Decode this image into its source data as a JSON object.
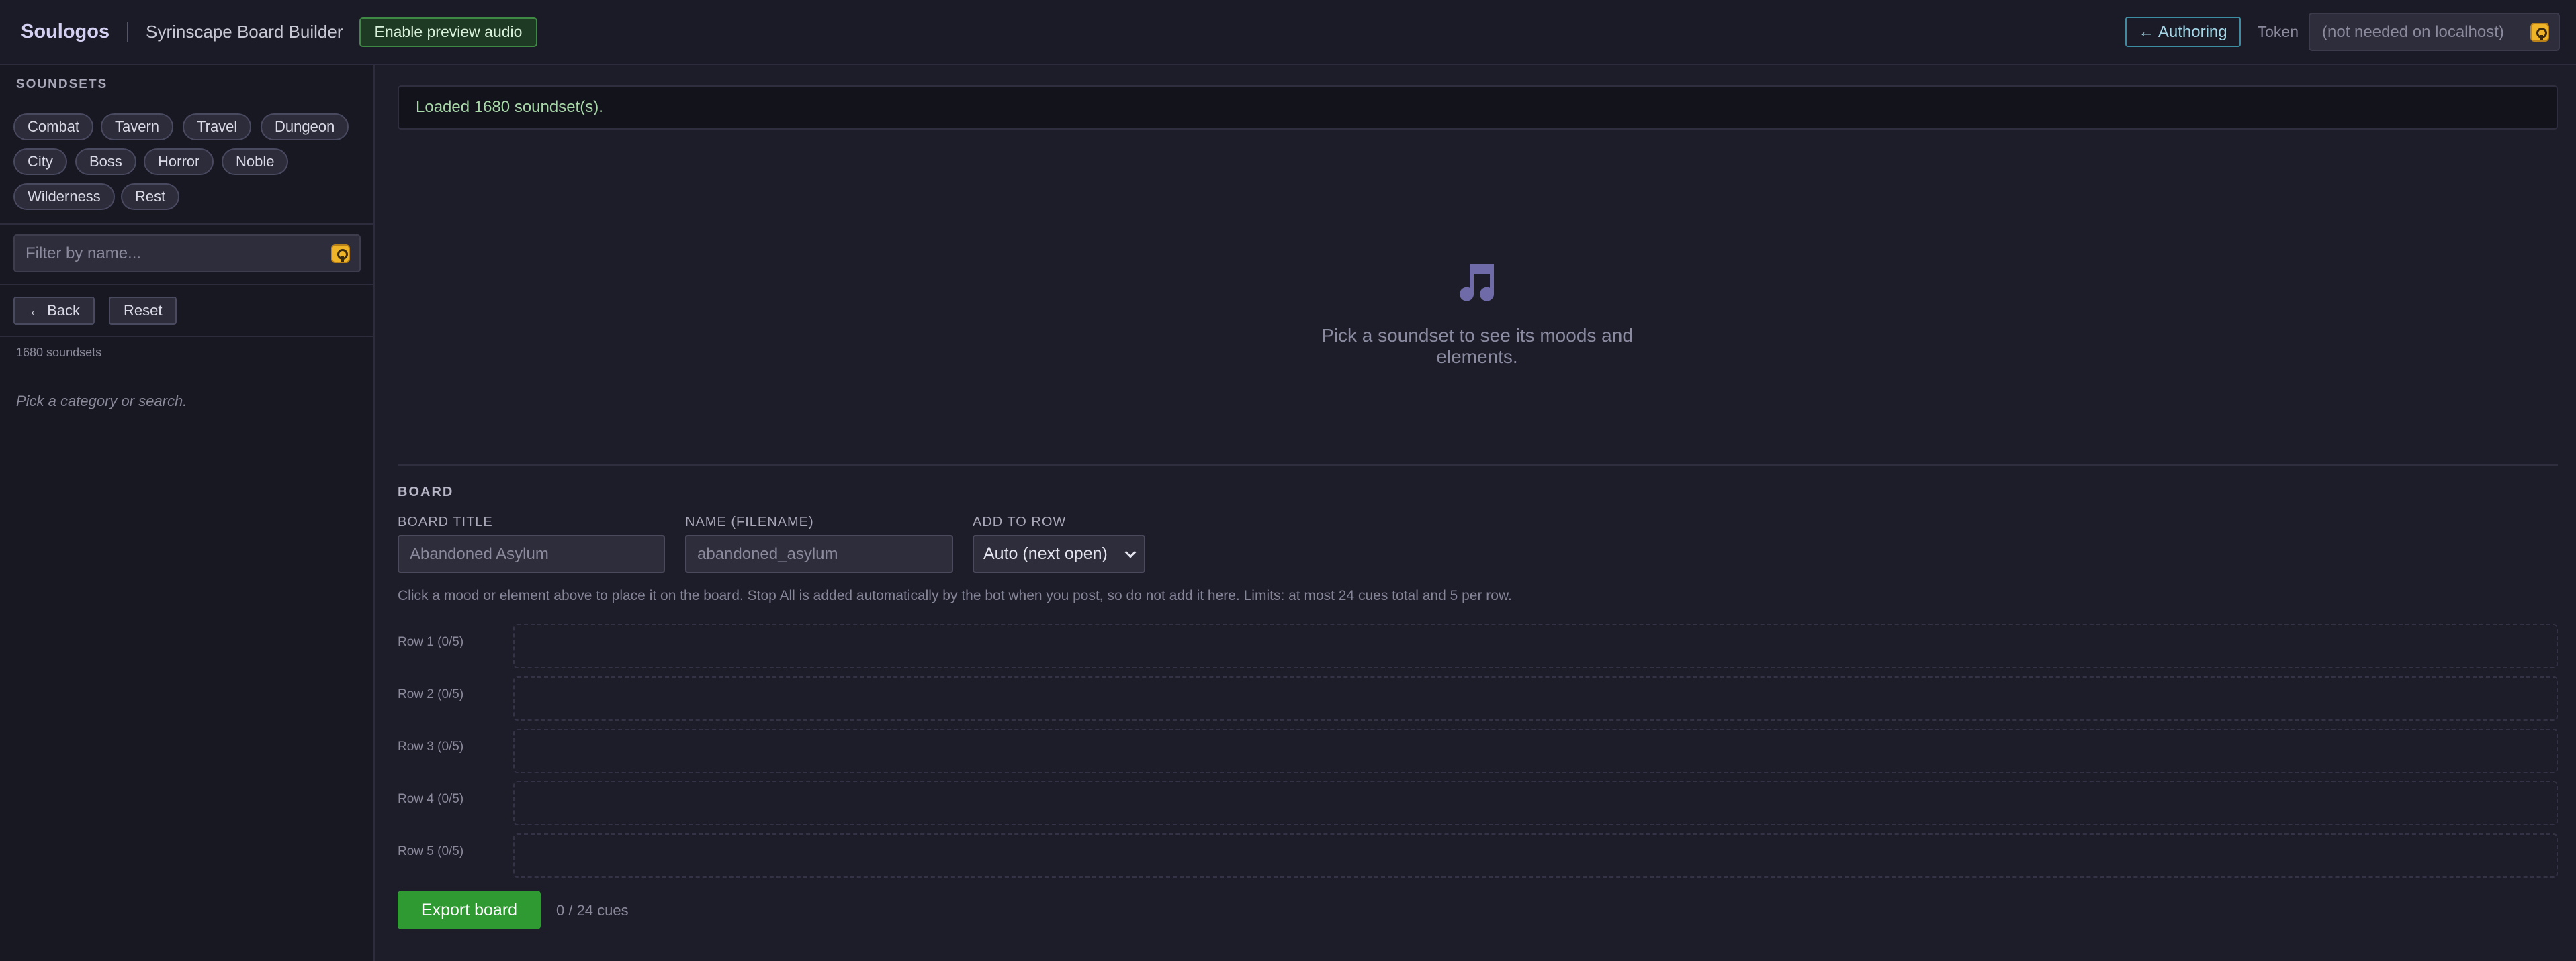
{
  "header": {
    "brand": "Soulogos",
    "app_title": "Syrinscape Board Builder",
    "preview_button": "Enable preview audio",
    "authoring_button": "← Authoring",
    "token_label": "Token",
    "token_placeholder": "(not needed on localhost)"
  },
  "sidebar": {
    "heading": "SOUNDSETS",
    "categories": [
      "Combat",
      "Tavern",
      "Travel",
      "Dungeon",
      "City",
      "Boss",
      "Horror",
      "Noble",
      "Wilderness",
      "Rest"
    ],
    "filter_placeholder": "Filter by name...",
    "back_button": "← Back",
    "reset_button": "Reset",
    "count_text": "1680 soundsets",
    "hint": "Pick a category or search."
  },
  "main": {
    "status": "Loaded 1680 soundset(s).",
    "empty_icon": "music-note-icon",
    "empty_text": "Pick a soundset to see its moods and elements."
  },
  "board": {
    "heading": "BOARD",
    "title_label": "BOARD TITLE",
    "title_placeholder": "Abandoned Asylum",
    "name_label": "NAME (FILENAME)",
    "name_placeholder": "abandoned_asylum",
    "row_label": "ADD TO ROW",
    "row_selected": "Auto (next open)",
    "help": "Click a mood or element above to place it on the board. Stop All is added automatically by the bot when you post, so do not add it here. Limits: at most 24 cues total and 5 per row.",
    "rows": [
      "Row 1 (0/5)",
      "Row 2 (0/5)",
      "Row 3 (0/5)",
      "Row 4 (0/5)",
      "Row 5 (0/5)"
    ],
    "export_button": "Export board",
    "cue_count": "0 / 24 cues"
  },
  "colors": {
    "accent_purple": "#d4d0f2",
    "export_green": "#2f9a32",
    "authoring_cyan": "#3c8da4",
    "status_green_text": "#a8d8a8"
  }
}
